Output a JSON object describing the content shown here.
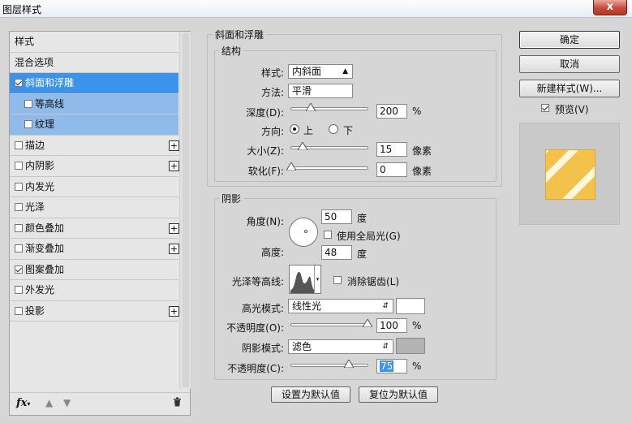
{
  "window": {
    "title": "图层样式",
    "close_label": "x"
  },
  "styles_list": {
    "items": [
      {
        "label": "样式",
        "checkbox": false,
        "checked": false,
        "plus": false,
        "state": "normal"
      },
      {
        "label": "混合选项",
        "checkbox": false,
        "checked": false,
        "plus": false,
        "state": "normal"
      },
      {
        "label": "斜面和浮雕",
        "checkbox": true,
        "checked": true,
        "plus": false,
        "state": "selected"
      },
      {
        "label": "等高线",
        "checkbox": true,
        "checked": false,
        "plus": false,
        "state": "sub"
      },
      {
        "label": "纹理",
        "checkbox": true,
        "checked": false,
        "plus": false,
        "state": "sub"
      },
      {
        "label": "描边",
        "checkbox": true,
        "checked": false,
        "plus": true,
        "state": "normal"
      },
      {
        "label": "内阴影",
        "checkbox": true,
        "checked": false,
        "plus": true,
        "state": "normal"
      },
      {
        "label": "内发光",
        "checkbox": true,
        "checked": false,
        "plus": false,
        "state": "normal"
      },
      {
        "label": "光泽",
        "checkbox": true,
        "checked": false,
        "plus": false,
        "state": "normal"
      },
      {
        "label": "颜色叠加",
        "checkbox": true,
        "checked": false,
        "plus": true,
        "state": "normal"
      },
      {
        "label": "渐变叠加",
        "checkbox": true,
        "checked": false,
        "plus": true,
        "state": "normal"
      },
      {
        "label": "图案叠加",
        "checkbox": true,
        "checked": true,
        "plus": false,
        "state": "normal"
      },
      {
        "label": "外发光",
        "checkbox": true,
        "checked": false,
        "plus": false,
        "state": "normal"
      },
      {
        "label": "投影",
        "checkbox": true,
        "checked": false,
        "plus": true,
        "state": "normal"
      }
    ],
    "fx_label": "fx",
    "plus_symbol": "+"
  },
  "bevel": {
    "group_title": "斜面和浮雕",
    "structure_title": "结构",
    "style_label": "样式:",
    "style_value": "内斜面",
    "technique_label": "方法:",
    "technique_value": "平滑",
    "depth_label": "深度(D):",
    "depth_value": "200",
    "depth_unit": "%",
    "depth_level": 0.25,
    "direction_label": "方向:",
    "direction_up": "上",
    "direction_down": "下",
    "direction_selected": "上",
    "size_label": "大小(Z):",
    "size_value": "15",
    "size_unit": "像素",
    "size_level": 0.15,
    "soften_label": "软化(F):",
    "soften_value": "0",
    "soften_unit": "像素",
    "soften_level": 0
  },
  "shading": {
    "title": "阴影",
    "angle_label": "角度(N):",
    "angle_value": "50",
    "angle_unit": "度",
    "global_light_label": "使用全局光(G)",
    "global_light_checked": false,
    "altitude_label": "高度:",
    "altitude_value": "48",
    "altitude_unit": "度",
    "gloss_contour_label": "光泽等高线:",
    "antialias_label": "消除锯齿(L)",
    "antialias_checked": false,
    "highlight_mode_label": "高光模式:",
    "highlight_mode_value": "线性光",
    "highlight_color": "#ffffff",
    "highlight_opacity_label": "不透明度(O):",
    "highlight_opacity_value": "100",
    "highlight_opacity_unit": "%",
    "highlight_opacity_level": 1.0,
    "shadow_mode_label": "阴影模式:",
    "shadow_mode_value": "滤色",
    "shadow_color": "#b3b3b3",
    "shadow_opacity_label": "不透明度(C):",
    "shadow_opacity_value": "75",
    "shadow_opacity_unit": "%",
    "shadow_opacity_level": 0.75
  },
  "actions": {
    "set_default": "设置为默认值",
    "reset_default": "复位为默认值",
    "ok": "确定",
    "cancel": "取消",
    "new_style": "新建样式(W)...",
    "preview_label": "预览(V)",
    "preview_checked": true
  },
  "colors": {
    "selected": "#3c93ec",
    "sub_selected": "#8fbbea",
    "preview_gold": "#f3c24a"
  }
}
